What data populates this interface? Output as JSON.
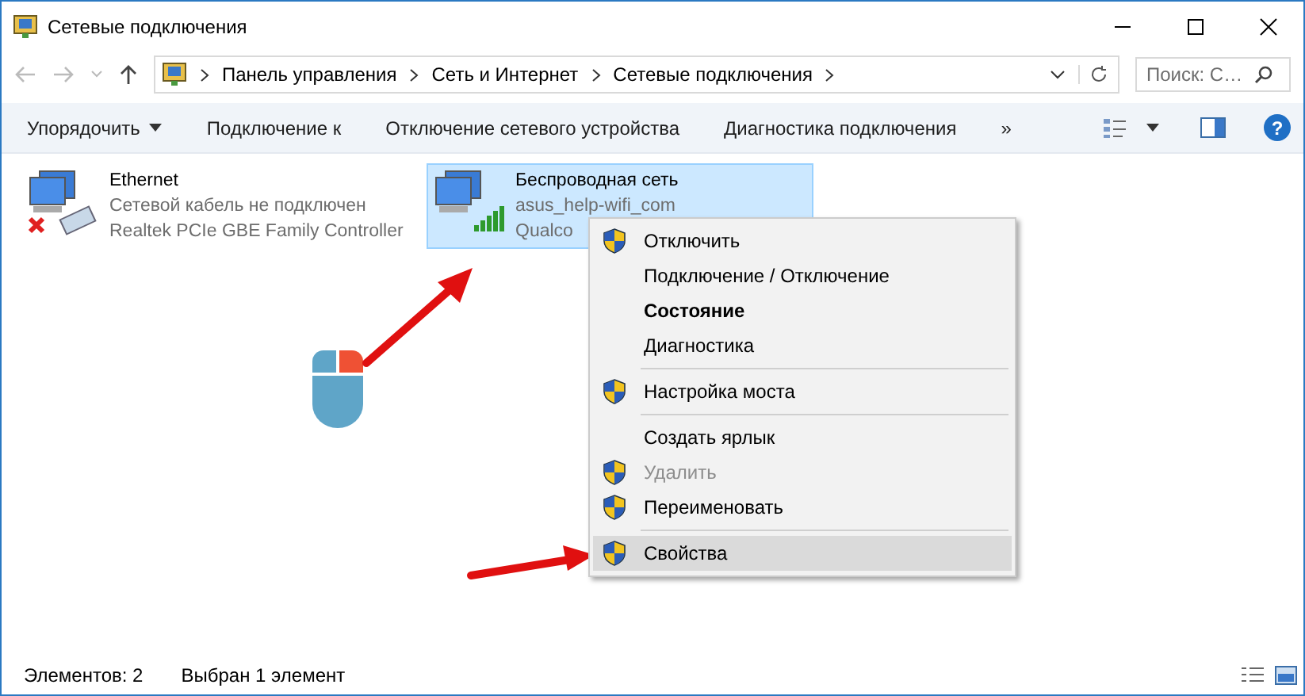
{
  "window": {
    "title": "Сетевые подключения"
  },
  "address": {
    "crumbs": [
      "Панель управления",
      "Сеть и Интернет",
      "Сетевые подключения"
    ]
  },
  "search": {
    "placeholder": "Поиск: С…"
  },
  "toolbar": {
    "items": [
      {
        "label": "Упорядочить",
        "dropdown": true
      },
      {
        "label": "Подключение к",
        "dropdown": false
      },
      {
        "label": "Отключение сетевого устройства",
        "dropdown": false
      },
      {
        "label": "Диагностика подключения",
        "dropdown": false
      }
    ],
    "more": "»",
    "help": "?"
  },
  "connections": [
    {
      "kind": "ethernet",
      "name": "Ethernet",
      "status": "Сетевой кабель не подключен",
      "device": "Realtek PCIe GBE Family Controller",
      "selected": false
    },
    {
      "kind": "wifi",
      "name": "Беспроводная сеть",
      "status": "asus_help-wifi_com",
      "device": "Qualco",
      "selected": true
    }
  ],
  "menu": {
    "items": [
      {
        "kind": "item",
        "label": "Отключить",
        "shield": true,
        "bold": false,
        "disabled": false,
        "selected": false
      },
      {
        "kind": "item",
        "label": "Подключение / Отключение",
        "shield": false,
        "bold": false,
        "disabled": false,
        "selected": false
      },
      {
        "kind": "item",
        "label": "Состояние",
        "shield": false,
        "bold": true,
        "disabled": false,
        "selected": false
      },
      {
        "kind": "item",
        "label": "Диагностика",
        "shield": false,
        "bold": false,
        "disabled": false,
        "selected": false
      },
      {
        "kind": "separator"
      },
      {
        "kind": "item",
        "label": "Настройка моста",
        "shield": true,
        "bold": false,
        "disabled": false,
        "selected": false
      },
      {
        "kind": "separator"
      },
      {
        "kind": "item",
        "label": "Создать ярлык",
        "shield": false,
        "bold": false,
        "disabled": false,
        "selected": false
      },
      {
        "kind": "item",
        "label": "Удалить",
        "shield": true,
        "bold": false,
        "disabled": true,
        "selected": false
      },
      {
        "kind": "item",
        "label": "Переименовать",
        "shield": true,
        "bold": false,
        "disabled": false,
        "selected": false
      },
      {
        "kind": "separator"
      },
      {
        "kind": "item",
        "label": "Свойства",
        "shield": true,
        "bold": false,
        "disabled": false,
        "selected": true
      }
    ]
  },
  "status_bar": {
    "items": [
      "Элементов: 2",
      "Выбран 1 элемент"
    ]
  }
}
